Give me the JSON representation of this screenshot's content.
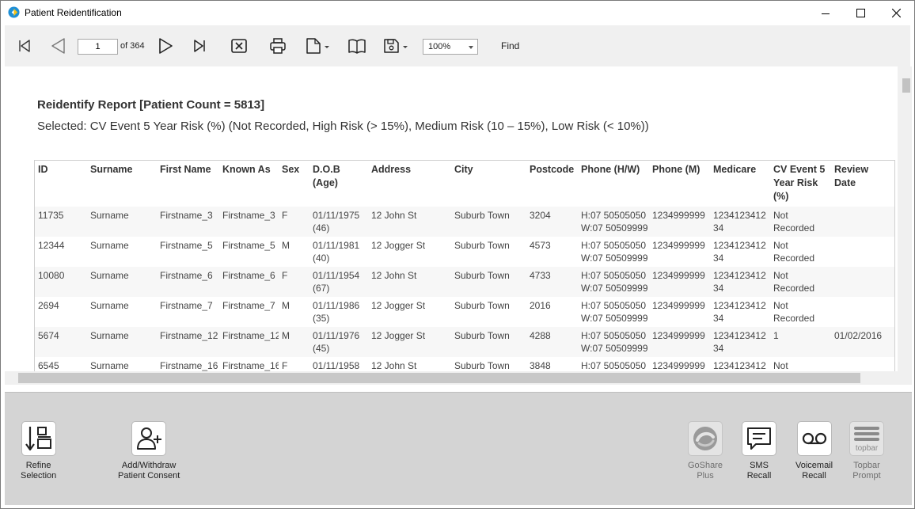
{
  "window": {
    "title": "Patient Reidentification"
  },
  "toolbar": {
    "page_value": "1",
    "page_of": "of 364",
    "zoom": "100%",
    "find_label": "Find"
  },
  "report": {
    "title": "Reidentify Report  [Patient Count = 5813]",
    "subtitle": "Selected: CV Event 5 Year Risk (%) (Not Recorded, High Risk (> 15%), Medium Risk (10 – 15%), Low Risk (< 10%))",
    "columns": [
      "ID",
      "Surname",
      "First Name",
      "Known As",
      "Sex",
      "D.O.B (Age)",
      "Address",
      "City",
      "Postcode",
      "Phone (H/W)",
      "Phone (M)",
      "Medicare",
      "CV Event 5 Year Risk (%)",
      "Review Date"
    ],
    "rows": [
      {
        "id": "11735",
        "surname": "Surname",
        "first": "Firstname_3",
        "known": "Firstname_3",
        "sex": "F",
        "dob": "01/11/1975",
        "age": "(46)",
        "address": "12 John St",
        "city": "Suburb Town",
        "postcode": "3204",
        "phone_h": "H:07 50505050",
        "phone_w": "W:07 50509999",
        "mobile": "1234999999",
        "medicare1": "1234123412",
        "medicare2": "34",
        "risk1": "Not",
        "risk2": "Recorded",
        "review": ""
      },
      {
        "id": "12344",
        "surname": "Surname",
        "first": "Firstname_5",
        "known": "Firstname_5",
        "sex": "M",
        "dob": "01/11/1981",
        "age": "(40)",
        "address": "12 Jogger St",
        "city": "Suburb Town",
        "postcode": "4573",
        "phone_h": "H:07 50505050",
        "phone_w": "W:07 50509999",
        "mobile": "1234999999",
        "medicare1": "1234123412",
        "medicare2": "34",
        "risk1": "Not",
        "risk2": "Recorded",
        "review": ""
      },
      {
        "id": "10080",
        "surname": "Surname",
        "first": "Firstname_6",
        "known": "Firstname_6",
        "sex": "F",
        "dob": "01/11/1954",
        "age": "(67)",
        "address": "12 John St",
        "city": "Suburb Town",
        "postcode": "4733",
        "phone_h": "H:07 50505050",
        "phone_w": "W:07 50509999",
        "mobile": "1234999999",
        "medicare1": "1234123412",
        "medicare2": "34",
        "risk1": "Not",
        "risk2": "Recorded",
        "review": ""
      },
      {
        "id": "2694",
        "surname": "Surname",
        "first": "Firstname_7",
        "known": "Firstname_7",
        "sex": "M",
        "dob": "01/11/1986",
        "age": "(35)",
        "address": "12 Jogger St",
        "city": "Suburb Town",
        "postcode": "2016",
        "phone_h": "H:07 50505050",
        "phone_w": "W:07 50509999",
        "mobile": "1234999999",
        "medicare1": "1234123412",
        "medicare2": "34",
        "risk1": "Not",
        "risk2": "Recorded",
        "review": ""
      },
      {
        "id": "5674",
        "surname": "Surname",
        "first": "Firstname_12",
        "known": "Firstname_12",
        "sex": "M",
        "dob": "01/11/1976",
        "age": "(45)",
        "address": "12 Jogger St",
        "city": "Suburb Town",
        "postcode": "4288",
        "phone_h": "H:07 50505050",
        "phone_w": "W:07 50509999",
        "mobile": "1234999999",
        "medicare1": "1234123412",
        "medicare2": "34",
        "risk1": "1",
        "risk2": "",
        "review": "01/02/2016"
      },
      {
        "id": "6545",
        "surname": "Surname",
        "first": "Firstname_16",
        "known": "Firstname_16",
        "sex": "F",
        "dob": "01/11/1958",
        "age": "",
        "address": "12 John St",
        "city": "Suburb Town",
        "postcode": "3848",
        "phone_h": "H:07 50505050",
        "phone_w": "",
        "mobile": "1234999999",
        "medicare1": "1234123412",
        "medicare2": "",
        "risk1": "Not",
        "risk2": "",
        "review": ""
      }
    ]
  },
  "actions": {
    "refine": "Refine\nSelection",
    "consent": "Add/Withdraw\nPatient Consent",
    "goshare": "GoShare\nPlus",
    "sms": "SMS\nRecall",
    "voicemail": "Voicemail\nRecall",
    "topbar": "Topbar\nPrompt",
    "topbar_logo_text": "topbar"
  },
  "colors": {
    "app_icon_blue": "#1e8fd6",
    "app_icon_yellow": "#f3c318",
    "panel_bg": "#d4d4d4",
    "toolbar_bg": "#f0f0f0"
  }
}
